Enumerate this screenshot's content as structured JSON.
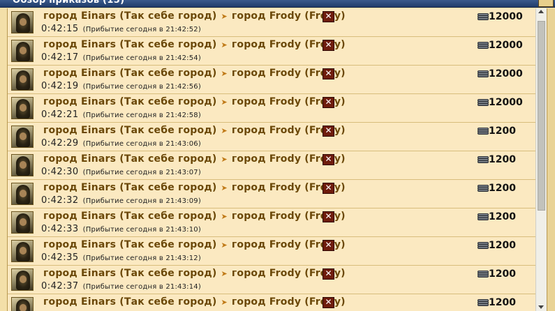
{
  "window": {
    "title": "Обзор приказов (15)"
  },
  "orders": [
    {
      "origin": "город Einars",
      "origin_note": "(Так себе город)",
      "target": "город Frody",
      "target_note": "(Frody)",
      "timer": "0:42:15",
      "arrival": "(Прибытие сегодня в 21:42:52)",
      "amount": "12000"
    },
    {
      "origin": "город Einars",
      "origin_note": "(Так себе город)",
      "target": "город Frody",
      "target_note": "(Frody)",
      "timer": "0:42:17",
      "arrival": "(Прибытие сегодня в 21:42:54)",
      "amount": "12000"
    },
    {
      "origin": "город Einars",
      "origin_note": "(Так себе город)",
      "target": "город Frody",
      "target_note": "(Frody)",
      "timer": "0:42:19",
      "arrival": "(Прибытие сегодня в 21:42:56)",
      "amount": "12000"
    },
    {
      "origin": "город Einars",
      "origin_note": "(Так себе город)",
      "target": "город Frody",
      "target_note": "(Frody)",
      "timer": "0:42:21",
      "arrival": "(Прибытие сегодня в 21:42:58)",
      "amount": "12000"
    },
    {
      "origin": "город Einars",
      "origin_note": "(Так себе город)",
      "target": "город Frody",
      "target_note": "(Frody)",
      "timer": "0:42:29",
      "arrival": "(Прибытие сегодня в 21:43:06)",
      "amount": "1200"
    },
    {
      "origin": "город Einars",
      "origin_note": "(Так себе город)",
      "target": "город Frody",
      "target_note": "(Frody)",
      "timer": "0:42:30",
      "arrival": "(Прибытие сегодня в 21:43:07)",
      "amount": "1200"
    },
    {
      "origin": "город Einars",
      "origin_note": "(Так себе город)",
      "target": "город Frody",
      "target_note": "(Frody)",
      "timer": "0:42:32",
      "arrival": "(Прибытие сегодня в 21:43:09)",
      "amount": "1200"
    },
    {
      "origin": "город Einars",
      "origin_note": "(Так себе город)",
      "target": "город Frody",
      "target_note": "(Frody)",
      "timer": "0:42:33",
      "arrival": "(Прибытие сегодня в 21:43:10)",
      "amount": "1200"
    },
    {
      "origin": "город Einars",
      "origin_note": "(Так себе город)",
      "target": "город Frody",
      "target_note": "(Frody)",
      "timer": "0:42:35",
      "arrival": "(Прибытие сегодня в 21:43:12)",
      "amount": "1200"
    },
    {
      "origin": "город Einars",
      "origin_note": "(Так себе город)",
      "target": "город Frody",
      "target_note": "(Frody)",
      "timer": "0:42:37",
      "arrival": "(Прибытие сегодня в 21:43:14)",
      "amount": "1200"
    },
    {
      "origin": "город Einars",
      "origin_note": "(Так себе город)",
      "target": "город Frody",
      "target_note": "(Frody)",
      "timer": "",
      "arrival": "",
      "amount": "1200"
    }
  ],
  "icons": {
    "avatar": "hooded-unit-avatar",
    "direction": "arrow-right-icon",
    "cancel": "close-icon",
    "resource": "silver-icon"
  },
  "colors": {
    "titlebar": "#2e4c7c",
    "row_background": "#fbe9c1",
    "link_text": "#6b4808",
    "cancel_button": "#6e1c0c"
  }
}
